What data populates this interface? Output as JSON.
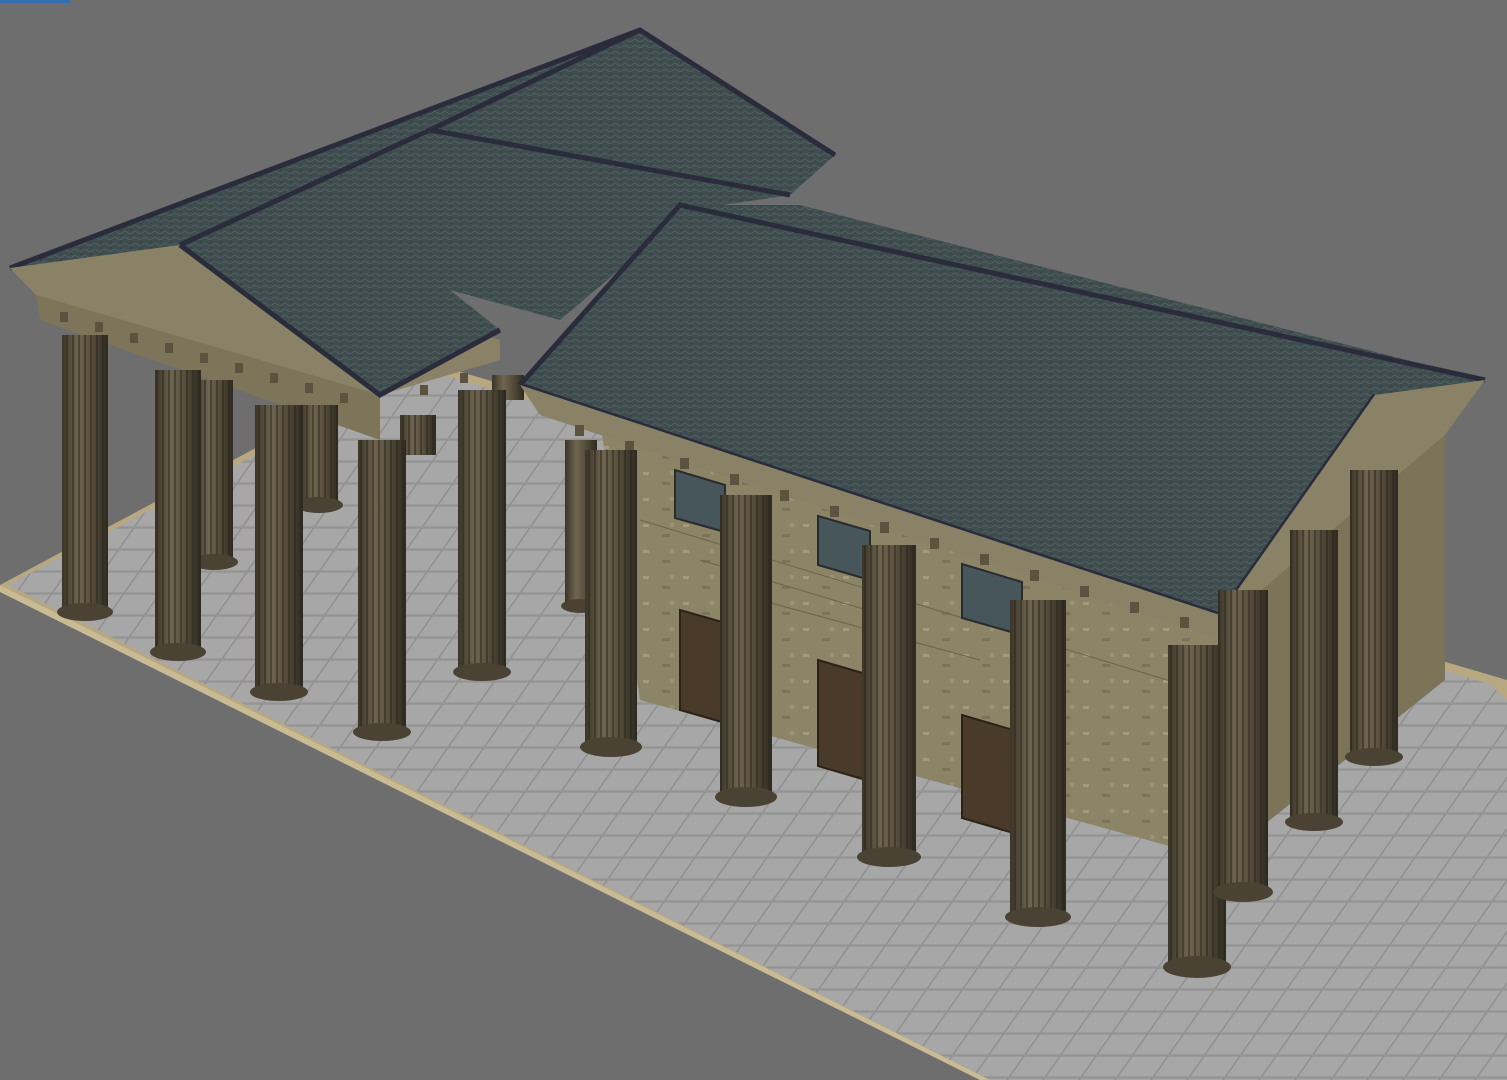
{
  "scene": {
    "colors": {
      "background": "#6e6e6e",
      "ground": "#9a9a9a",
      "ground_edge": "#b8a882",
      "roof": "#3d4b4d",
      "roof_ridge": "#2a2c3c",
      "wall": "#8a8266",
      "column": "#5e5643",
      "column_dark": "#3b3528",
      "window_glass": "#46565a",
      "shutter": "#4a3a2a"
    }
  }
}
